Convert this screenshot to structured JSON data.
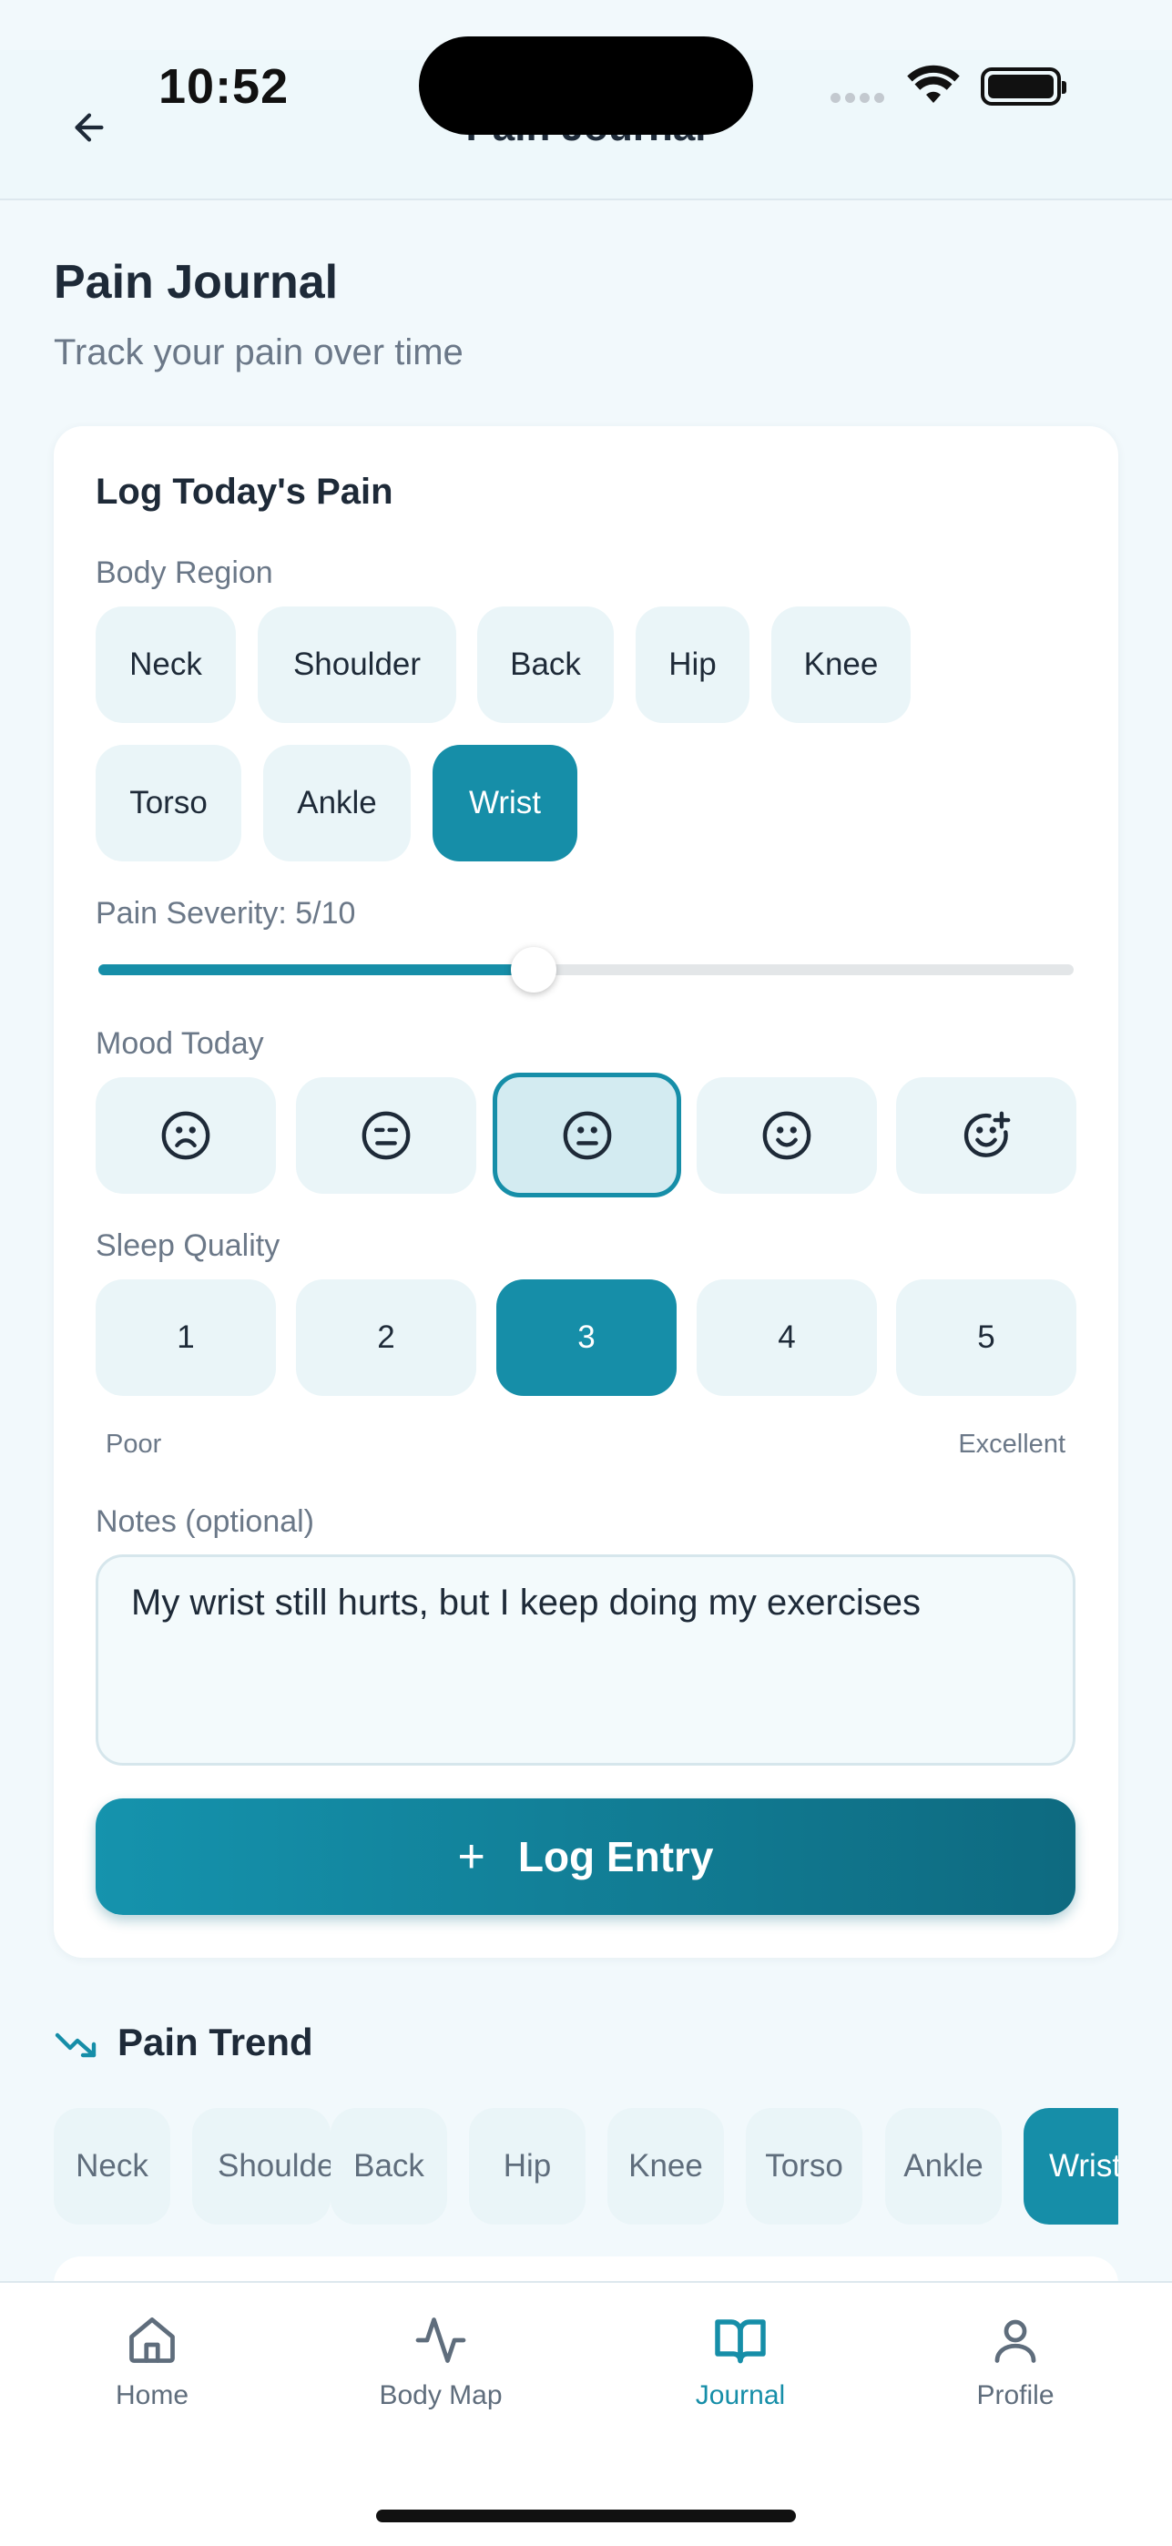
{
  "status": {
    "time": "10:52"
  },
  "nav": {
    "title": "Pain Journal"
  },
  "header": {
    "title": "Pain Journal",
    "subtitle": "Track your pain over time"
  },
  "log_card": {
    "title": "Log Today's Pain",
    "body_region_label": "Body Region",
    "regions": [
      "Neck",
      "Shoulder",
      "Back",
      "Hip",
      "Knee",
      "Torso",
      "Ankle",
      "Wrist"
    ],
    "selected_region": "Wrist",
    "severity_label": "Pain Severity: 5/10",
    "severity_value": 5,
    "severity_max": 10,
    "mood_label": "Mood Today",
    "moods": [
      "very-sad-face-icon",
      "unhappy-face-icon",
      "neutral-face-icon",
      "happy-face-icon",
      "very-happy-face-icon"
    ],
    "selected_mood_index": 2,
    "sleep_label": "Sleep Quality",
    "sleep_options": [
      "1",
      "2",
      "3",
      "4",
      "5"
    ],
    "selected_sleep": "3",
    "sleep_low": "Poor",
    "sleep_high": "Excellent",
    "notes_label": "Notes (optional)",
    "notes_value": "My wrist still hurts, but I keep doing my exercises",
    "submit_label": "Log Entry"
  },
  "trend": {
    "title": "Pain Trend",
    "regions": [
      "Neck",
      "Shoulder",
      "Back",
      "Hip",
      "Knee",
      "Torso",
      "Ankle",
      "Wrist"
    ],
    "selected": "Wrist"
  },
  "tabs": [
    {
      "label": "Home",
      "icon": "home-icon"
    },
    {
      "label": "Body Map",
      "icon": "activity-icon"
    },
    {
      "label": "Journal",
      "icon": "book-open-icon",
      "active": true
    },
    {
      "label": "Profile",
      "icon": "user-icon"
    }
  ],
  "colors": {
    "accent": "#168ea8",
    "background": "#f2f9fc",
    "chip": "#eaf5f8"
  }
}
